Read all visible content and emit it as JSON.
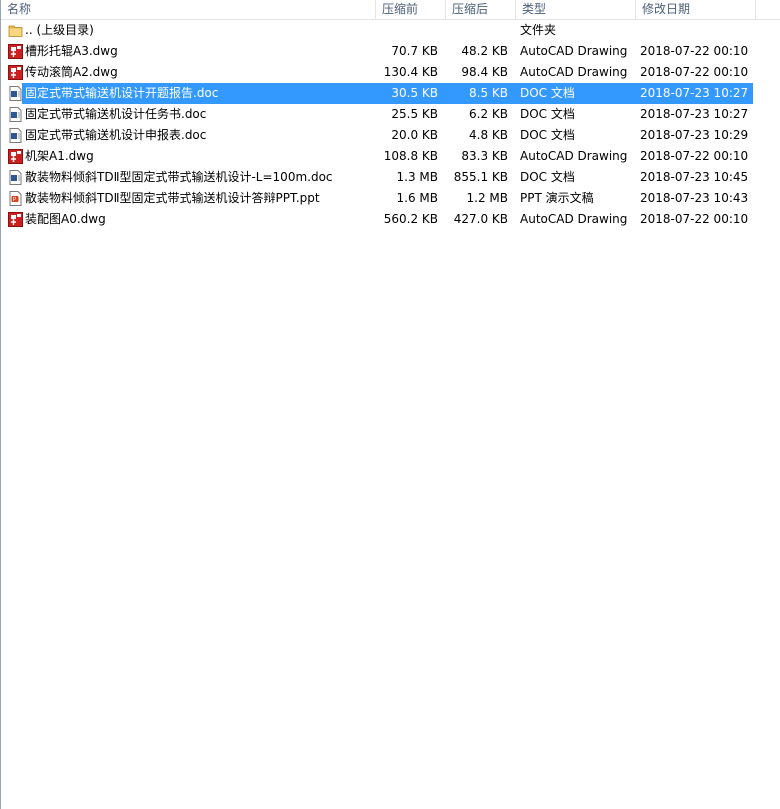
{
  "columns": {
    "name": "名称",
    "compressed": "压缩前",
    "original": "压缩后",
    "type": "类型",
    "modified": "修改日期"
  },
  "colors": {
    "selection": "#3399ff",
    "header_text": "#4c607a",
    "dwg_icon": "#cc1f1f",
    "doc_icon": "#2b5797",
    "folder_icon": "#e8b64c"
  },
  "rows": [
    {
      "name": ".. (上级目录)",
      "size": "",
      "packed": "",
      "type": "文件夹",
      "date": "",
      "icon": "folder-icon",
      "selected": false
    },
    {
      "name": "槽形托辊A3.dwg",
      "size": "70.7 KB",
      "packed": "48.2 KB",
      "type": "AutoCAD Drawing",
      "date": "2018-07-22 00:10",
      "icon": "dwg-file-icon",
      "selected": false
    },
    {
      "name": "传动滚筒A2.dwg",
      "size": "130.4 KB",
      "packed": "98.4 KB",
      "type": "AutoCAD Drawing",
      "date": "2018-07-22 00:10",
      "icon": "dwg-file-icon",
      "selected": false
    },
    {
      "name": "固定式带式输送机设计开题报告.doc",
      "size": "30.5 KB",
      "packed": "8.5 KB",
      "type": "DOC 文档",
      "date": "2018-07-23 10:27",
      "icon": "doc-file-icon",
      "selected": true
    },
    {
      "name": "固定式带式输送机设计任务书.doc",
      "size": "25.5 KB",
      "packed": "6.2 KB",
      "type": "DOC 文档",
      "date": "2018-07-23 10:27",
      "icon": "doc-file-icon",
      "selected": false
    },
    {
      "name": "固定式带式输送机设计申报表.doc",
      "size": "20.0 KB",
      "packed": "4.8 KB",
      "type": "DOC 文档",
      "date": "2018-07-23 10:29",
      "icon": "doc-file-icon",
      "selected": false
    },
    {
      "name": "机架A1.dwg",
      "size": "108.8 KB",
      "packed": "83.3 KB",
      "type": "AutoCAD Drawing",
      "date": "2018-07-22 00:10",
      "icon": "dwg-file-icon",
      "selected": false
    },
    {
      "name": "散装物料倾斜TDⅡ型固定式带式输送机设计-L=100m.doc",
      "size": "1.3 MB",
      "packed": "855.1 KB",
      "type": "DOC 文档",
      "date": "2018-07-23 10:45",
      "icon": "doc-file-icon",
      "selected": false
    },
    {
      "name": "散装物料倾斜TDⅡ型固定式带式输送机设计答辩PPT.ppt",
      "size": "1.6 MB",
      "packed": "1.2 MB",
      "type": "PPT 演示文稿",
      "date": "2018-07-23 10:43",
      "icon": "ppt-file-icon",
      "selected": false
    },
    {
      "name": "装配图A0.dwg",
      "size": "560.2 KB",
      "packed": "427.0 KB",
      "type": "AutoCAD Drawing",
      "date": "2018-07-22 00:10",
      "icon": "dwg-file-icon",
      "selected": false
    }
  ]
}
